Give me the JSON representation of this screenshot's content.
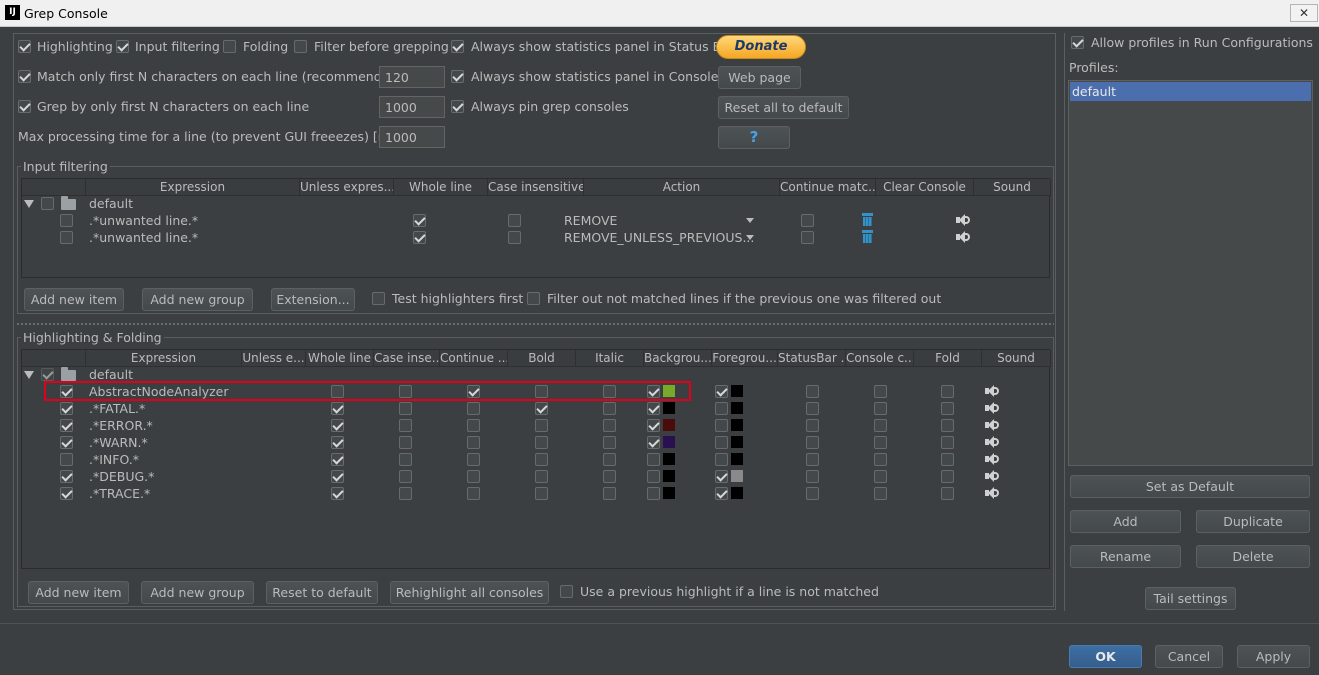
{
  "window": {
    "title": "Grep Console",
    "app_icon": "IJ"
  },
  "options": {
    "highlighting": {
      "label": "Highlighting",
      "checked": true
    },
    "input_filtering": {
      "label": "Input filtering",
      "checked": true
    },
    "folding": {
      "label": "Folding",
      "checked": false
    },
    "filter_before_grepping": {
      "label": "Filter before grepping",
      "checked": false
    },
    "stats_status_bar": {
      "label": "Always show statistics panel in Status Bar",
      "checked": true
    },
    "match_first_n": {
      "label": "Match only first N characters on each line (recommended)",
      "checked": true,
      "value": "120"
    },
    "stats_console": {
      "label": "Always show statistics panel in Console",
      "checked": true
    },
    "grep_first_n": {
      "label": "Grep by only first N characters on each line",
      "checked": true,
      "value": "1000"
    },
    "pin_grep": {
      "label": "Always pin grep consoles",
      "checked": true
    },
    "max_time": {
      "label": "Max processing time for a line (to prevent GUI freeezes) [ms]",
      "value": "1000"
    }
  },
  "side_buttons": {
    "donate": "Donate",
    "web_page": "Web page",
    "reset_all": "Reset all to default",
    "help": "?"
  },
  "input_filtering": {
    "legend": "Input filtering",
    "columns": [
      "Expression",
      "Unless expres...",
      "Whole line",
      "Case insensitive",
      "Action",
      "Continue matc...",
      "Clear Console",
      "Sound"
    ],
    "group": "default",
    "rows": [
      {
        "expression": ".*unwanted line.*",
        "action": "REMOVE"
      },
      {
        "expression": ".*unwanted line.*",
        "action": "REMOVE_UNLESS_PREVIOUS..."
      }
    ],
    "buttons": {
      "add_item": "Add new item",
      "add_group": "Add new group",
      "extension": "Extension..."
    },
    "test_highlighters": "Test highlighters first",
    "filter_out": "Filter out not matched lines if the previous one was filtered out"
  },
  "highlighting": {
    "legend": "Highlighting & Folding",
    "columns": [
      "Expression",
      "Unless e...",
      "Whole line",
      "Case inse...",
      "Continue ...",
      "Bold",
      "Italic",
      "Backgrou...",
      "Foregrou...",
      "StatusBar ...",
      "Console c...",
      "Fold",
      "Sound"
    ],
    "group": "default",
    "rows": [
      {
        "expression": "AbstractNodeAnalyzer",
        "enabled": true,
        "whole": false,
        "cont": true,
        "bold": false,
        "bg_on": true,
        "bg": "#78a928",
        "fg_on": true,
        "fg": "#000000"
      },
      {
        "expression": ".*FATAL.*",
        "enabled": true,
        "whole": true,
        "cont": false,
        "bold": true,
        "bg_on": true,
        "bg": "#000000",
        "fg_on": false,
        "fg": "#000000"
      },
      {
        "expression": ".*ERROR.*",
        "enabled": true,
        "whole": true,
        "cont": false,
        "bold": false,
        "bg_on": true,
        "bg": "#4a0b0b",
        "fg_on": false,
        "fg": "#000000"
      },
      {
        "expression": ".*WARN.*",
        "enabled": true,
        "whole": true,
        "cont": false,
        "bold": false,
        "bg_on": true,
        "bg": "#2a1050",
        "fg_on": false,
        "fg": "#000000"
      },
      {
        "expression": ".*INFO.*",
        "enabled": false,
        "whole": true,
        "cont": false,
        "bold": false,
        "bg_on": false,
        "bg": "#000000",
        "fg_on": false,
        "fg": "#000000"
      },
      {
        "expression": ".*DEBUG.*",
        "enabled": true,
        "whole": true,
        "cont": false,
        "bold": false,
        "bg_on": false,
        "bg": "#000000",
        "fg_on": true,
        "fg": "#8a8a8a"
      },
      {
        "expression": ".*TRACE.*",
        "enabled": true,
        "whole": true,
        "cont": false,
        "bold": false,
        "bg_on": false,
        "bg": "#000000",
        "fg_on": true,
        "fg": "#000000"
      }
    ],
    "buttons": {
      "add_item": "Add new item",
      "add_group": "Add new group",
      "reset": "Reset to default",
      "rehighlight": "Rehighlight all consoles"
    },
    "use_previous": "Use a previous highlight if a line is not matched"
  },
  "profiles": {
    "allow_label": "Allow profiles in Run Configurations",
    "title": "Profiles:",
    "items": [
      "default"
    ],
    "buttons": {
      "set_default": "Set as Default",
      "add": "Add",
      "duplicate": "Duplicate",
      "rename": "Rename",
      "delete": "Delete",
      "tail": "Tail settings"
    }
  },
  "footer": {
    "ok": "OK",
    "cancel": "Cancel",
    "apply": "Apply"
  },
  "colors": {
    "accent": "#4b6eaf",
    "highlight_box": "#e0001b",
    "background": "#3c3f41"
  }
}
